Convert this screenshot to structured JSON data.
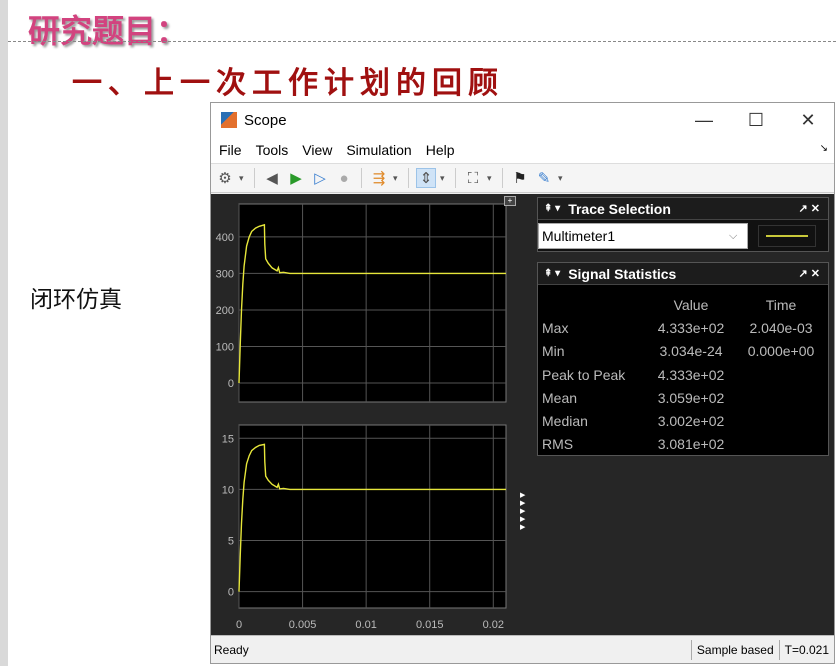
{
  "slide": {
    "heading": "研究题目：",
    "subtitle": "一、上一次工作计划的回顾",
    "side_label": "闭环仿真"
  },
  "window": {
    "title": "Scope",
    "menu": [
      "File",
      "Tools",
      "View",
      "Simulation",
      "Help"
    ],
    "toolbar_icons": [
      "gear-icon",
      "step-back-icon",
      "run-icon",
      "step-forward-icon",
      "stop-icon",
      "highlight-block-icon",
      "zoom-icon",
      "fit-to-view-icon",
      "triggers-icon",
      "measurements-icon"
    ],
    "status": {
      "left": "Ready",
      "mode": "Sample based",
      "time": "T=0.021"
    }
  },
  "trace_selection": {
    "title": "Trace Selection",
    "value": "Multimeter1",
    "line_color": "#c9c93a"
  },
  "signal_statistics": {
    "title": "Signal Statistics",
    "columns": [
      "",
      "Value",
      "Time"
    ],
    "rows": [
      {
        "label": "Max",
        "value": "4.333e+02",
        "time": "2.040e-03"
      },
      {
        "label": "Min",
        "value": "3.034e-24",
        "time": "0.000e+00"
      },
      {
        "label": "Peak to Peak",
        "value": "4.333e+02",
        "time": ""
      },
      {
        "label": "Mean",
        "value": "3.059e+02",
        "time": ""
      },
      {
        "label": "Median",
        "value": "3.002e+02",
        "time": ""
      },
      {
        "label": "RMS",
        "value": "3.081e+02",
        "time": ""
      }
    ]
  },
  "chart_data": [
    {
      "type": "line",
      "xlim": [
        0,
        0.021
      ],
      "ylim": [
        -52,
        490
      ],
      "xticks": [
        "0",
        "0.005",
        "0.01",
        "0.015",
        "0.02"
      ],
      "yticks": [
        "0",
        "100",
        "200",
        "300",
        "400"
      ],
      "grid": true,
      "color": "#e6e63a",
      "x": [
        0,
        0.0001,
        0.0002,
        0.0003,
        0.0004,
        0.0006,
        0.0008,
        0.001,
        0.0013,
        0.0016,
        0.002,
        0.00203,
        0.0021,
        0.0023,
        0.0026,
        0.003,
        0.0031,
        0.0032,
        0.0035,
        0.004,
        0.005,
        0.021
      ],
      "y": [
        0,
        110,
        200,
        270,
        320,
        375,
        400,
        415,
        424,
        429,
        433,
        380,
        340,
        328,
        315,
        307,
        316,
        302,
        303,
        300,
        300,
        300
      ]
    },
    {
      "type": "line",
      "xlim": [
        0,
        0.021
      ],
      "ylim": [
        -1.6,
        16.3
      ],
      "xticks": [
        "0",
        "0.005",
        "0.01",
        "0.015",
        "0.02"
      ],
      "yticks": [
        "0",
        "5",
        "10",
        "15"
      ],
      "grid": true,
      "color": "#e6e63a",
      "x": [
        0,
        0.0001,
        0.0002,
        0.0003,
        0.0004,
        0.0006,
        0.0008,
        0.001,
        0.0013,
        0.0016,
        0.002,
        0.00203,
        0.0021,
        0.0023,
        0.0026,
        0.003,
        0.0031,
        0.0032,
        0.0035,
        0.004,
        0.005,
        0.021
      ],
      "y": [
        0,
        3.7,
        6.7,
        9,
        10.7,
        12.5,
        13.3,
        13.8,
        14.1,
        14.3,
        14.4,
        12.7,
        11.3,
        10.9,
        10.5,
        10.2,
        10.5,
        10.05,
        10.1,
        10,
        10,
        10
      ]
    }
  ]
}
